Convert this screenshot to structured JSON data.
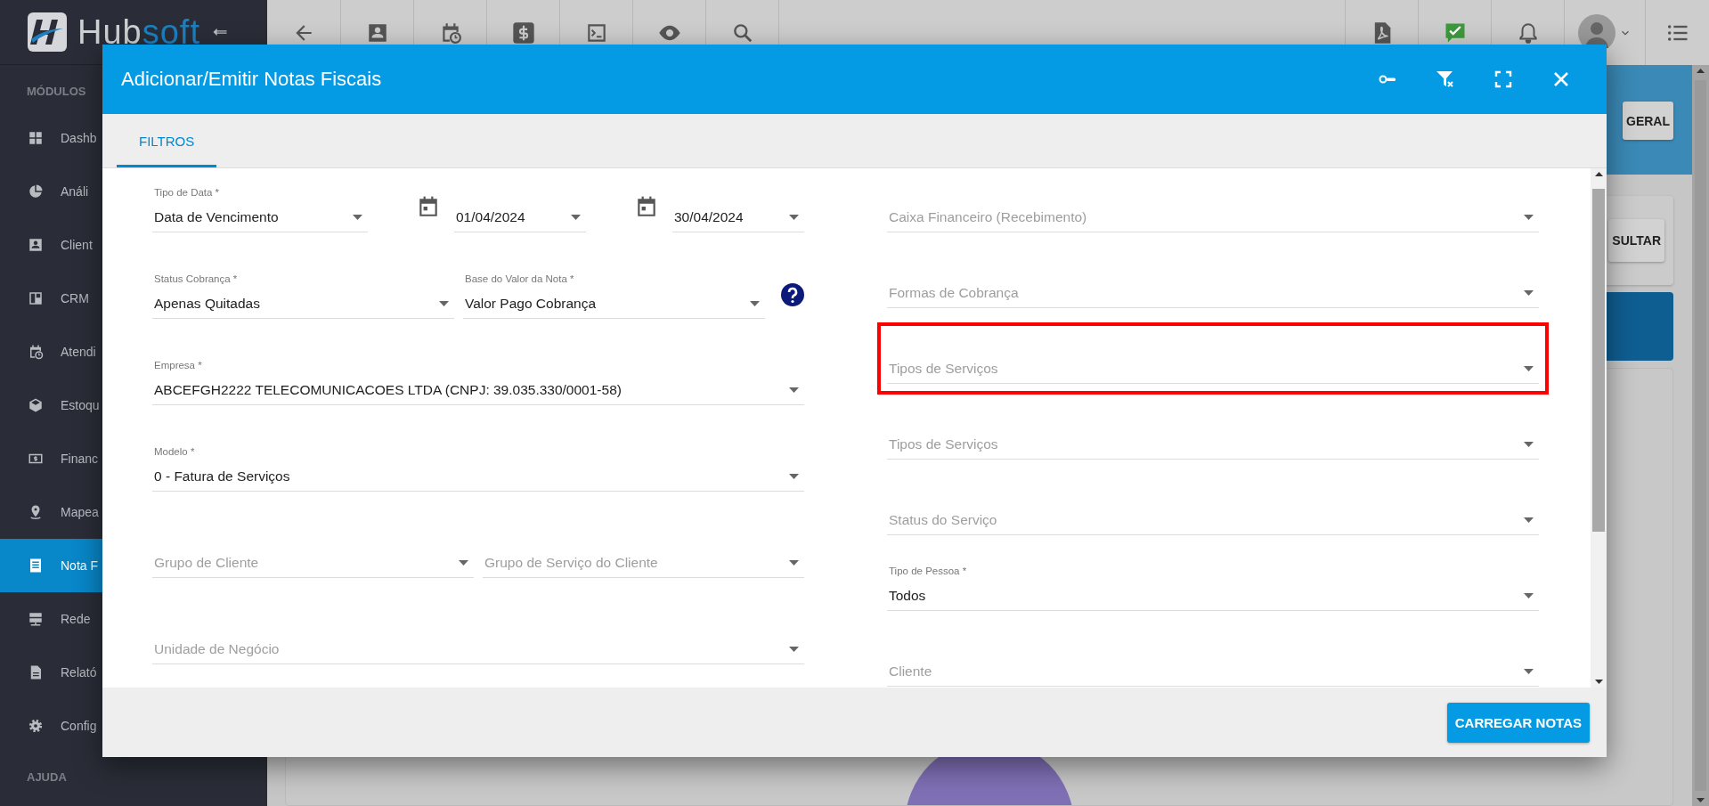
{
  "sidebar": {
    "logo": {
      "text": "Hub",
      "accent": "soft"
    },
    "section_title": "MÓDULOS",
    "items": [
      {
        "label": "Dashb",
        "selected": false
      },
      {
        "label": "Análi",
        "selected": false
      },
      {
        "label": "Client",
        "selected": false
      },
      {
        "label": "CRM",
        "selected": false
      },
      {
        "label": "Atendi",
        "selected": false
      },
      {
        "label": "Estoqu",
        "selected": false
      },
      {
        "label": "Financ",
        "selected": false
      },
      {
        "label": "Mapea",
        "selected": false
      },
      {
        "label": "Nota F",
        "selected": true
      },
      {
        "label": "Rede",
        "selected": false
      },
      {
        "label": "Relató",
        "selected": false
      },
      {
        "label": "Config",
        "selected": false
      }
    ],
    "footer_title": "AJUDA"
  },
  "background": {
    "header_button": "GERAL",
    "card_button": "SULTAR"
  },
  "dialog": {
    "title": "Adicionar/Emitir Notas Fiscais",
    "tabs": [
      {
        "label": "FILTROS",
        "selected": true
      }
    ],
    "left_rows": [
      [
        {
          "kind": "select",
          "label": "Tipo de Data *",
          "value": "Data de Vencimento"
        },
        {
          "kind": "date",
          "value": "01/04/2024"
        },
        {
          "kind": "date",
          "value": "30/04/2024"
        }
      ],
      [
        {
          "kind": "select",
          "label": "Status Cobrança *",
          "value": "Apenas Quitadas"
        },
        {
          "kind": "select",
          "label": "Base do Valor da Nota *",
          "value": "Valor Pago Cobrança"
        },
        {
          "kind": "help"
        }
      ],
      [
        {
          "kind": "select",
          "label": "Empresa *",
          "value": "ABCEFGH2222 TELECOMUNICACOES LTDA (CNPJ: 39.035.330/0001-58)"
        }
      ],
      [
        {
          "kind": "select",
          "label": "Modelo *",
          "value": "0 - Fatura de Serviços"
        }
      ],
      [
        {
          "kind": "select",
          "placeholder": "Grupo de Cliente"
        },
        {
          "kind": "select",
          "placeholder": "Grupo de Serviço do Cliente"
        }
      ],
      [
        {
          "kind": "select",
          "placeholder": "Unidade de Negócio"
        }
      ]
    ],
    "right_fields": [
      {
        "placeholder": "Caixa Financeiro (Recebimento)",
        "highlighted": false
      },
      {
        "placeholder": "Formas de Cobrança",
        "highlighted": false
      },
      {
        "placeholder": "Tipos de Serviços",
        "highlighted": true
      },
      {
        "placeholder": "Tipos de Serviços",
        "highlighted": false
      },
      {
        "placeholder": "Status do Serviço",
        "highlighted": false
      },
      {
        "label": "Tipo de Pessoa *",
        "value": "Todos",
        "highlighted": false
      },
      {
        "placeholder": "Cliente",
        "highlighted": false
      }
    ],
    "submit_button": "CARREGAR NOTAS"
  }
}
